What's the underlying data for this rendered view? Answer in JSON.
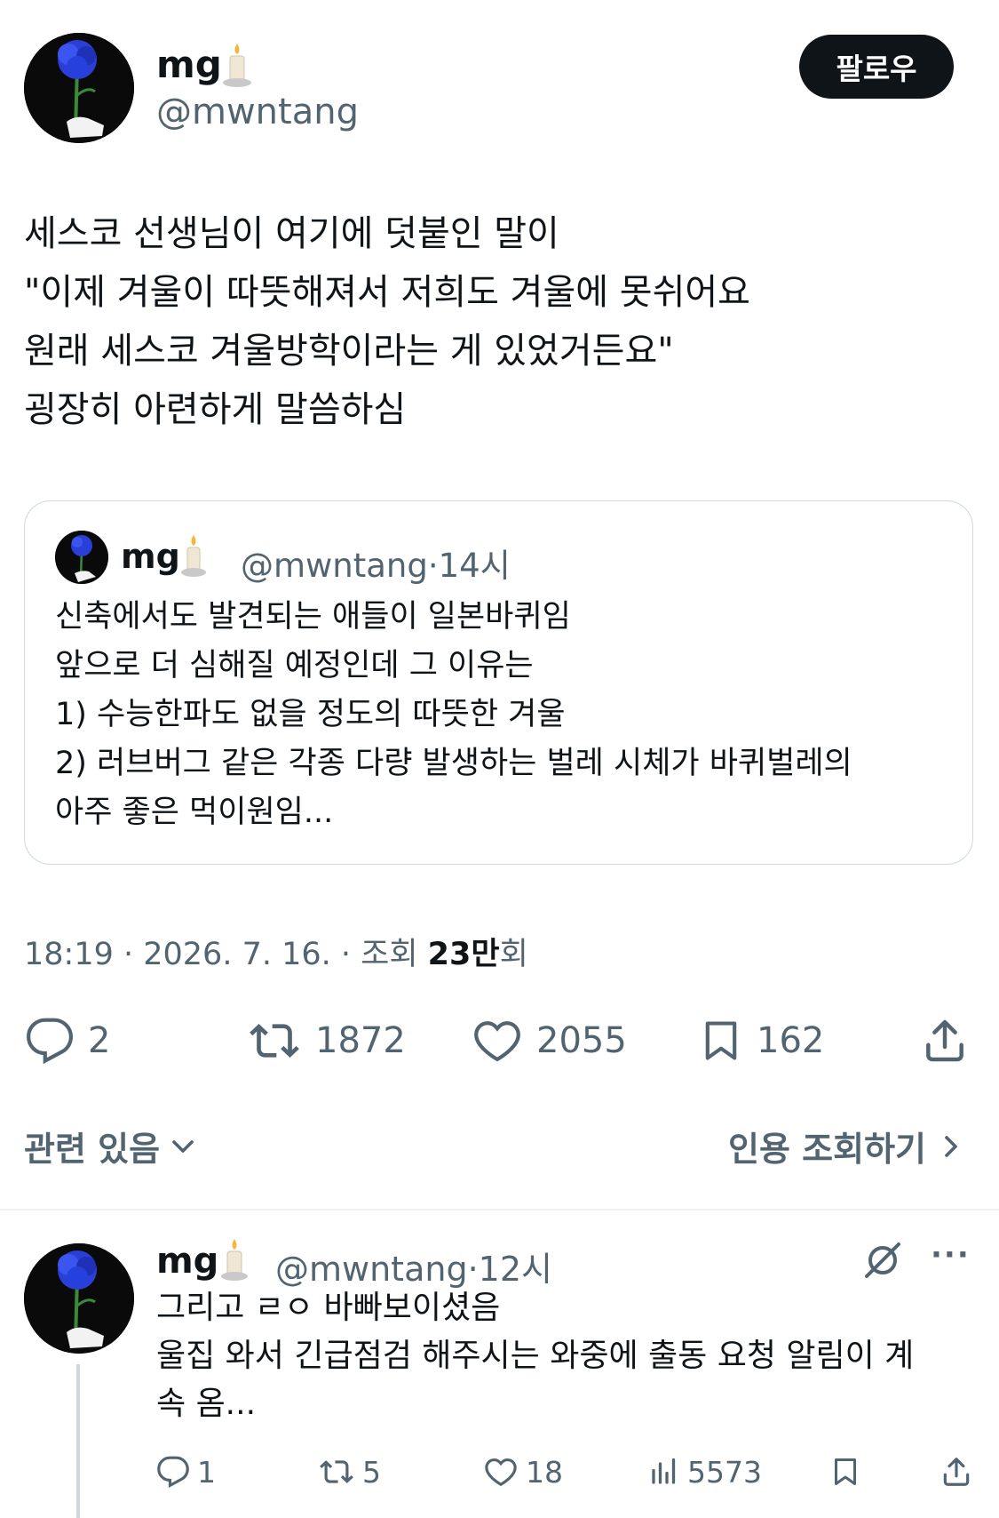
{
  "tweet": {
    "author_name": "mg",
    "author_handle": "@mwntang",
    "follow_label": "팔로우",
    "body_lines": [
      "세스코 선생님이 여기에 덧붙인 말이",
      "\"이제 겨울이 따뜻해져서 저희도 겨울에 못쉬어요",
      "원래 세스코 겨울방학이라는 게 있었거든요\"",
      "굉장히 아련하게 말씀하심"
    ],
    "quoted": {
      "author_name": "mg",
      "author_handle": "@mwntang",
      "dot": "·",
      "time": "14시",
      "lines": [
        "신축에서도 발견되는 애들이 일본바퀴임",
        "앞으로 더 심해질 예정인데 그 이유는",
        "1) 수능한파도 없을 정도의 따뜻한 겨울",
        "2) 러브버그 같은 각종 다량 발생하는 벌레 시체가 바퀴벌레의",
        "아주 좋은 먹이원임..."
      ]
    },
    "meta": {
      "datetime": "18:19 · 2026. 7. 16. · 조회 ",
      "views": "23만",
      "views_suffix": "회"
    },
    "actions": {
      "replies": "2",
      "retweets": "1872",
      "likes": "2055",
      "bookmarks": "162"
    },
    "related_label": "관련 있음",
    "quote_view_label": "인용 조회하기"
  },
  "reply": {
    "author_name": "mg",
    "author_handle": "@mwntang",
    "dot": "·",
    "time": "12시",
    "more": "···",
    "lines": [
      "그리고 ㄹㅇ 바빠보이셨음",
      "울집 와서 긴급점검 해주시는 와중에 출동 요청 알림이 계",
      "속 옴..."
    ],
    "actions": {
      "replies": "1",
      "retweets": "5",
      "likes": "18",
      "views": "5573"
    }
  },
  "colors": {
    "text": "#0f1419",
    "muted": "#536471",
    "rose": "#2b3fd6",
    "border": "#cfd9de"
  },
  "icons": [
    "candle-icon",
    "reply-icon",
    "retweet-icon",
    "heart-icon",
    "bookmark-icon",
    "share-icon",
    "chevron-down-icon",
    "chevron-right-icon",
    "grok-icon",
    "more-icon",
    "views-icon"
  ]
}
